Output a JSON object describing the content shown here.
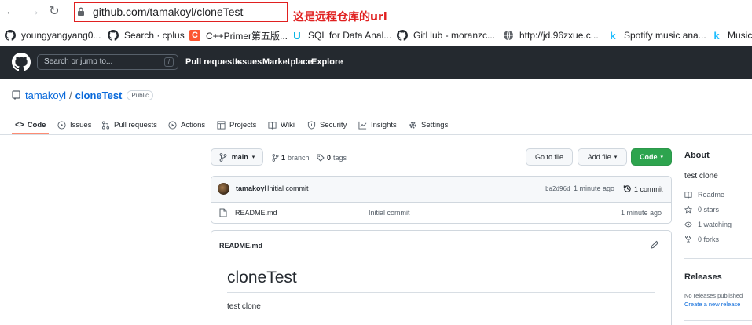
{
  "browser": {
    "url": "github.com/tamakoyl/cloneTest",
    "annotation": "这是远程仓库的url",
    "bookmarks": [
      {
        "label": "youngyangyang0...",
        "icon": "github-icon"
      },
      {
        "label": "Search · cplus",
        "icon": "github-icon"
      },
      {
        "label": "C++Primer第五版...",
        "icon": "csdn-icon"
      },
      {
        "label": "SQL for Data Anal...",
        "icon": "udacity-icon"
      },
      {
        "label": "GitHub - moranzc...",
        "icon": "github-icon"
      },
      {
        "label": "http://jd.96zxue.c...",
        "icon": "globe-icon"
      },
      {
        "label": "Spotify music ana...",
        "icon": "kaggle-icon"
      },
      {
        "label": "Music",
        "icon": "kaggle-icon"
      }
    ]
  },
  "header": {
    "search_placeholder": "Search or jump to...",
    "slash": "/",
    "nav": [
      "Pull requests",
      "Issues",
      "Marketplace",
      "Explore"
    ]
  },
  "repo": {
    "owner": "tamakoyl",
    "sep": "/",
    "name": "cloneTest",
    "visibility": "Public"
  },
  "tabs": [
    "Code",
    "Issues",
    "Pull requests",
    "Actions",
    "Projects",
    "Wiki",
    "Security",
    "Insights",
    "Settings"
  ],
  "branchbar": {
    "branch": "main",
    "branches_count": "1",
    "branches_label": "branch",
    "tags_count": "0",
    "tags_label": "tags",
    "go_to_file": "Go to file",
    "add_file": "Add file",
    "code": "Code"
  },
  "commit": {
    "author": "tamakoyl",
    "message": "Initial commit",
    "sha": "ba2d96d",
    "time": "1 minute ago",
    "count": "1 commit"
  },
  "files": [
    {
      "name": "README.md",
      "message": "Initial commit",
      "time": "1 minute ago"
    }
  ],
  "readme": {
    "header": "README.md",
    "title": "cloneTest",
    "body": "test clone"
  },
  "sidebar": {
    "about_title": "About",
    "description": "test clone",
    "readme": "Readme",
    "stars": "0 stars",
    "watching": "1 watching",
    "forks": "0 forks",
    "releases_title": "Releases",
    "no_releases": "No releases published",
    "create_release": "Create a new release"
  },
  "colors": {
    "accent": "#0969da",
    "header_bg": "#24292f",
    "green": "#2da44e",
    "annotation": "#e02020",
    "tab_underline": "#fd8c73"
  }
}
